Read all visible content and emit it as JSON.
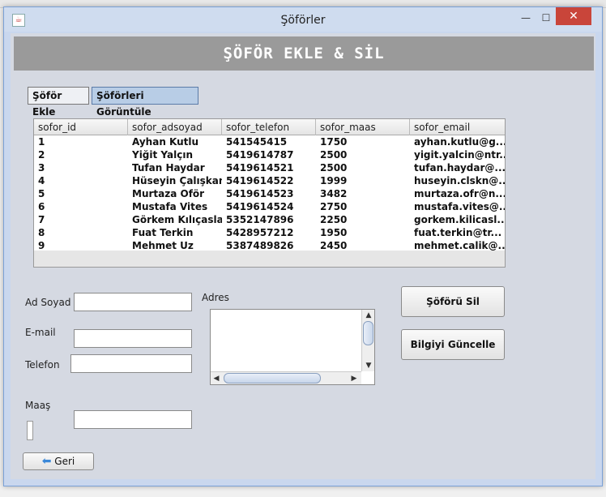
{
  "window": {
    "title": "Şöförler"
  },
  "controls": {
    "minimize": "—",
    "maximize": "☐",
    "close": "✕"
  },
  "banner": {
    "title": "ŞÖFÖR EKLE & SİL"
  },
  "tabs": [
    {
      "label": "Şöför Ekle",
      "active": false
    },
    {
      "label": "Şöförleri Görüntüle",
      "active": true
    }
  ],
  "table": {
    "columns": [
      "sofor_id",
      "sofor_adsoyad",
      "sofor_telefon",
      "sofor_maas",
      "sofor_email"
    ],
    "rows": [
      [
        "1",
        "Ayhan Kutlu",
        "541545415",
        "1750",
        "ayhan.kutlu@g..."
      ],
      [
        "2",
        "Yiğit Yalçın",
        "5419614787",
        "2500",
        "yigit.yalcin@ntr..."
      ],
      [
        "3",
        "Tufan Haydar",
        "5419614521",
        "2500",
        "tufan.haydar@..."
      ],
      [
        "4",
        "Hüseyin Çalışkan",
        "5419614522",
        "1999",
        "huseyin.clskn@..."
      ],
      [
        "5",
        "Murtaza Oför",
        "5419614523",
        "3482",
        "murtaza.ofr@n..."
      ],
      [
        "6",
        "Mustafa Vites",
        "5419614524",
        "2750",
        "mustafa.vites@..."
      ],
      [
        "7",
        "Görkem Kılıçaslan",
        "5352147896",
        "2250",
        "gorkem.kilicasl..."
      ],
      [
        "8",
        "Fuat Terkin",
        "5428957212",
        "1950",
        "fuat.terkin@tr..."
      ],
      [
        "9",
        "Mehmet Uz",
        "5387489826",
        "2450",
        "mehmet.calik@..."
      ]
    ]
  },
  "form": {
    "adsoyad_label": "Ad Soyad",
    "email_label": "E-mail",
    "telefon_label": "Telefon",
    "maas_label": "Maaş",
    "adres_label": "Adres",
    "adsoyad_value": "",
    "email_value": "",
    "telefon_value": "",
    "maas_value": "",
    "adres_value": ""
  },
  "buttons": {
    "delete": "Şöförü Sil",
    "update": "Bilgiyi Güncelle",
    "back": "Geri"
  },
  "colors": {
    "banner": "#9a9a9a",
    "active_tab": "#b8cde6",
    "close": "#c9453a"
  }
}
